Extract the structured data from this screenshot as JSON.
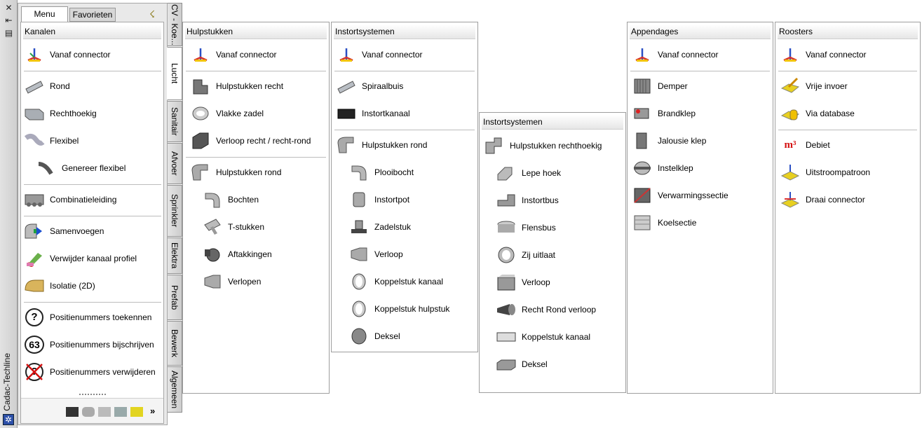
{
  "window": {
    "title": "Cadac-Techline",
    "close_glyph": "✕",
    "pin_glyph": "⇤",
    "props_glyph": "▤",
    "logo_glyph": "✲"
  },
  "tabs": {
    "menu": "Menu",
    "favorites": "Favorieten"
  },
  "pin_icon_glyph": "☇",
  "side_tabs": [
    "CV - Koe...",
    "Lucht",
    "Sanitair",
    "Afvoer",
    "Sprinkler",
    "Elektra",
    "Prefab",
    "Bewerk",
    "Algemeen"
  ],
  "main": {
    "header": "Kanalen",
    "items": [
      {
        "label": "Vanaf connector",
        "icon": "connector-axes-icon"
      },
      {
        "label": "Rond",
        "icon": "round-duct-icon"
      },
      {
        "label": "Rechthoekig",
        "icon": "rectangular-duct-icon"
      },
      {
        "label": "Flexibel",
        "icon": "flexible-duct-icon"
      },
      {
        "label": "Genereer flexibel",
        "icon": "generate-flexible-icon"
      },
      {
        "label": "Combinatieleiding",
        "icon": "combination-pipe-icon"
      },
      {
        "label": "Samenvoegen",
        "icon": "merge-icon"
      },
      {
        "label": "Verwijder kanaal profiel",
        "icon": "remove-profile-icon"
      },
      {
        "label": "Isolatie (2D)",
        "icon": "insulation-icon"
      },
      {
        "label": "Positienummers toekennen",
        "icon": "question-circle-icon",
        "glyph": "?"
      },
      {
        "label": "Positienummers bijschrijven",
        "icon": "number-circle-icon",
        "glyph": "63"
      },
      {
        "label": "Positienummers verwijderen",
        "icon": "delete-number-icon",
        "glyph": "?"
      }
    ],
    "more_glyph": "»"
  },
  "panels": {
    "hulpstukken": {
      "header": "Hulpstukken",
      "items": [
        "Vanaf connector",
        "Hulpstukken recht",
        "Vlakke zadel",
        "Verloop recht / recht-rond",
        "Hulpstukken rond",
        "Bochten",
        "T-stukken",
        "Aftakkingen",
        "Verlopen"
      ]
    },
    "instort_rond": {
      "header": "Instortsystemen",
      "items": [
        "Vanaf connector",
        "Spiraalbuis",
        "Instortkanaal",
        "Hulpstukken rond",
        "Plooibocht",
        "Instortpot",
        "Zadelstuk",
        "Verloop",
        "Koppelstuk kanaal",
        "Koppelstuk hulpstuk",
        "Deksel"
      ]
    },
    "instort_recht": {
      "header": "Instortsystemen",
      "items": [
        "Hulpstukken rechthoekig",
        "Lepe hoek",
        "Instortbus",
        "Flensbus",
        "Zij uitlaat",
        "Verloop",
        "Recht Rond verloop",
        "Koppelstuk kanaal",
        "Deksel"
      ]
    },
    "appendages": {
      "header": "Appendages",
      "items": [
        "Vanaf connector",
        "Demper",
        "Brandklep",
        "Jalousie klep",
        "Instelklep",
        "Verwarmingssectie",
        "Koelsectie"
      ]
    },
    "roosters": {
      "header": "Roosters",
      "items": [
        "Vanaf connector",
        "Vrije invoer",
        "Via database",
        "Debiet",
        "Uitstroompatroon",
        "Draai connector"
      ],
      "debiet_glyph": "m³"
    }
  }
}
